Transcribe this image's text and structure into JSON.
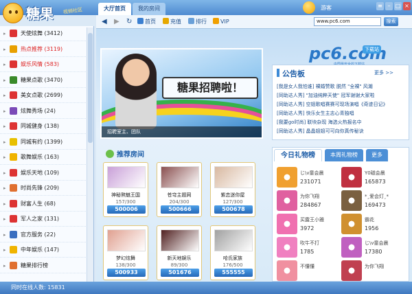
{
  "app": {
    "logo_text": "糖果",
    "logo_tag": "视频社区"
  },
  "tabs": {
    "hall": "大厅首页",
    "mine": "我的房间"
  },
  "user": {
    "name": "游客"
  },
  "toolbar": {
    "home": "首页",
    "recharge": "充值",
    "rank": "排行",
    "vip": "VIP",
    "address": "www.pc6.com",
    "search": "搜索"
  },
  "sidebar": [
    {
      "label": "天使炫舞 (3412)",
      "color": "#222",
      "icon_color": "#d33"
    },
    {
      "label": "热点推荐 (3119)",
      "color": "#d22",
      "icon_color": "#e8a000"
    },
    {
      "label": "娱乐风情 (583)",
      "color": "#d22",
      "icon_color": "#d33"
    },
    {
      "label": "糖果点歌 (3470)",
      "color": "#222",
      "icon_color": "#3a8a2a"
    },
    {
      "label": "美女点歌 (2699)",
      "color": "#222",
      "icon_color": "#d33"
    },
    {
      "label": "炫舞秀场 (24)",
      "color": "#222",
      "icon_color": "#7b4bb8"
    },
    {
      "label": "同城健身 (138)",
      "color": "#222",
      "icon_color": "#d33"
    },
    {
      "label": "同城有约 (1399)",
      "color": "#222",
      "icon_color": "#e8c000"
    },
    {
      "label": "歌舞娱乐 (163)",
      "color": "#222",
      "icon_color": "#f0b400"
    },
    {
      "label": "娱乐天地 (109)",
      "color": "#222",
      "icon_color": "#d33"
    },
    {
      "label": "时尚先锋 (209)",
      "color": "#222",
      "icon_color": "#e07030"
    },
    {
      "label": "财富人生 (68)",
      "color": "#222",
      "icon_color": "#d33"
    },
    {
      "label": "军人之家 (131)",
      "color": "#222",
      "icon_color": "#d33"
    },
    {
      "label": "官方服务 (22)",
      "color": "#222",
      "icon_color": "#3b6fc0"
    },
    {
      "label": "中年娱乐 (147)",
      "color": "#222",
      "icon_color": "#f0b400"
    },
    {
      "label": "糖果排行榜",
      "color": "#222",
      "icon_color": "#e07030"
    }
  ],
  "status": {
    "text": "同时在线人数: 15831"
  },
  "banner": {
    "headline": "糖果招聘啦！",
    "caption": "招聘室主、团队"
  },
  "recommend": {
    "title": "推荐房间"
  },
  "rooms": [
    {
      "name": "神秘煞魅王国",
      "count": "157/300",
      "id": "500006",
      "color": "#c9a0d8"
    },
    {
      "name": "苍穹主题网",
      "count": "204/300",
      "id": "500666",
      "color": "#8a5050"
    },
    {
      "name": "紫恋迷你屋",
      "count": "127/300",
      "id": "500678",
      "color": "#d8b8a0"
    },
    {
      "name": "梦幻炫舞",
      "count": "138/300",
      "id": "500933",
      "color": "#e0a090"
    },
    {
      "name": "新天地娱乐",
      "count": "89/300",
      "id": "501676",
      "color": "#502020"
    },
    {
      "name": "哈氏家族",
      "count": "176/500",
      "id": "555555",
      "color": "#a0a0a0"
    }
  ],
  "announce": {
    "title": "公告板",
    "more": "更多 >>",
    "lines": [
      "[我是女人我怕谁] 裸婚赞歌 脱然 \"全裸\" 风潮",
      "[同助达人秀] \"加油纯粹天使\" 冠军谢谢大家啦",
      "[同助达人秀] 空姐歌唱赛赛可现场演唱《奇迹日记》",
      "[同助达人秀] 快乐女生主志心青独唱",
      "[我要go时尚] 联块杂现 海选火热报名中",
      "[同助达人秀] 晶晶姐姐可可向你真传秘诀"
    ]
  },
  "gifts": {
    "tab_today": "今日礼物榜",
    "tab_week": "本周礼物榜",
    "tab_more": "更多",
    "items": [
      {
        "name": "じ\\v童会晨",
        "value": "231071",
        "color": "#f0a030"
      },
      {
        "name": "Y0磁会晨",
        "value": "165873",
        "color": "#c03040"
      },
      {
        "name": "为你飞翔",
        "value": "284867",
        "color": "#e060a0"
      },
      {
        "name": "*¸爱会灯¸*",
        "value": "169473",
        "color": "#7a6040"
      },
      {
        "name": "买露王小雅",
        "value": "3972",
        "color": "#f070b0"
      },
      {
        "name": "霸花",
        "value": "1956",
        "color": "#d09030"
      },
      {
        "name": "吹牛不打",
        "value": "1785",
        "color": "#f080c0"
      },
      {
        "name": "じ\\v童会晨",
        "value": "17380",
        "color": "#c060c0"
      },
      {
        "name": "不懂懂",
        "value": "",
        "color": "#f090a0"
      },
      {
        "name": "为你飞翔",
        "value": "",
        "color": "#c04050"
      }
    ]
  }
}
